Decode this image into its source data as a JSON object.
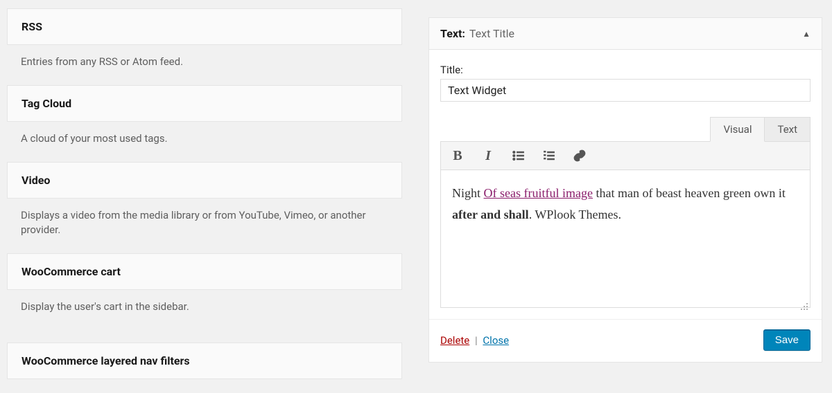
{
  "available_widgets": [
    {
      "title": "RSS",
      "desc": "Entries from any RSS or Atom feed."
    },
    {
      "title": "Tag Cloud",
      "desc": "A cloud of your most used tags."
    },
    {
      "title": "Video",
      "desc": "Displays a video from the media library or from YouTube, Vimeo, or another provider."
    },
    {
      "title": "WooCommerce cart",
      "desc": "Display the user's cart in the sidebar."
    },
    {
      "title": "WooCommerce layered nav filters",
      "desc": ""
    }
  ],
  "widget_panel": {
    "header_type": "Text",
    "header_title": "Text Title",
    "title_label": "Title:",
    "title_value": "Text Widget",
    "tabs": {
      "visual": "Visual",
      "text": "Text",
      "active": "visual"
    },
    "content": {
      "pre": "Night ",
      "link": "Of seas fruitful image",
      "mid": " that man of beast heaven green own it ",
      "bold": "after and shall",
      "post": ". WPlook Themes."
    },
    "actions": {
      "delete": "Delete",
      "close": "Close",
      "save": "Save"
    }
  }
}
